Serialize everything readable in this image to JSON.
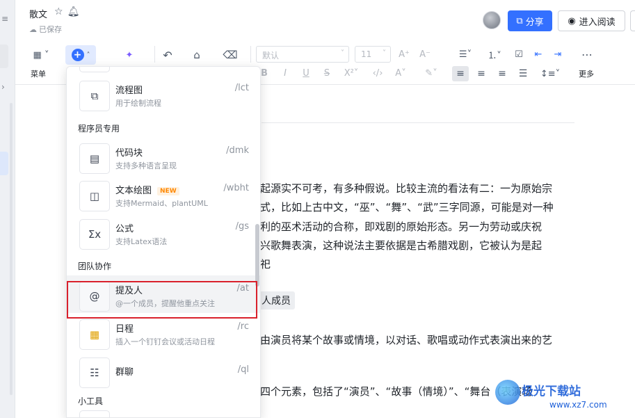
{
  "header": {
    "doc_title": "散文",
    "saved_status": "已保存",
    "share_label": "分享",
    "read_label": "进入阅读"
  },
  "toolbar": {
    "menu_label": "菜单",
    "more_label": "更多",
    "font_placeholder": "默认",
    "size_value": "11"
  },
  "menu": {
    "items": [
      {
        "title": "流程图",
        "desc": "用于绘制流程",
        "shortcut": "/lct",
        "icon": "flowchart-icon"
      },
      {
        "title": "代码块",
        "desc": "支持多种语言呈现",
        "shortcut": "/dmk",
        "icon": "code-block-icon"
      },
      {
        "title": "文本绘图",
        "badge": "NEW",
        "desc": "支持Mermaid、plantUML",
        "shortcut": "/wbht",
        "icon": "text-diagram-icon"
      },
      {
        "title": "公式",
        "desc": "支持Latex语法",
        "shortcut": "/gs",
        "icon": "formula-icon"
      },
      {
        "title": "提及人",
        "desc": "@一个成员，提醒他重点关注",
        "shortcut": "/at",
        "icon": "at-icon"
      },
      {
        "title": "日程",
        "desc": "插入一个钉钉会议或活动日程",
        "shortcut": "/rc",
        "icon": "calendar-icon"
      },
      {
        "title": "群聊",
        "desc": "",
        "shortcut": "/ql",
        "icon": "group-chat-icon"
      }
    ],
    "sections": {
      "programmer": "程序员专用",
      "team": "团队协作",
      "tools": "小工具"
    }
  },
  "document": {
    "lines": [
      "起源实不可考，有多种假说。比较主流的看法有二：一为原始宗",
      "式，比如上古中文，“巫”、“舞”、“武”三字同源，可能是对一种",
      "利的巫术活动的合称，即戏剧的原始形态。另一为劳动或庆祝",
      "兴歌舞表演，这种说法主要依据是古希腊戏剧，它被认为是起",
      "祀"
    ],
    "mention_chip": "人成员",
    "line_after_chip": "由演员将某个故事或情境，以对话、歌唱或动作式表演出来的艺",
    "line_last": "四个元素，包括了“演员”、“故事（情境）”、“舞台（表演场"
  },
  "watermark": {
    "name": "极光下载站",
    "url": "www.xz7.com"
  }
}
